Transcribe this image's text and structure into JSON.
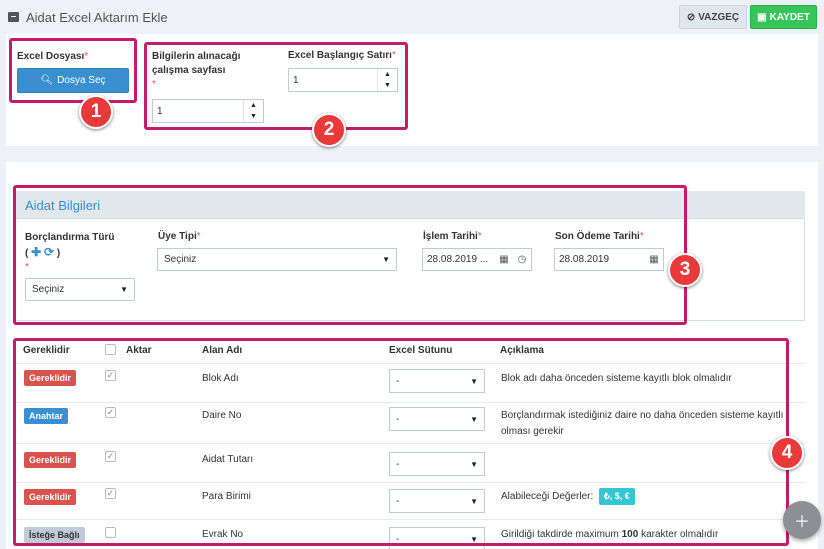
{
  "header": {
    "title": "Aidat Excel Aktarım Ekle",
    "cancel_label": "VAZGEÇ",
    "save_label": "KAYDET"
  },
  "upload": {
    "file_label": "Excel Dosyası",
    "file_button": "Dosya Seç",
    "sheet_label_line1": "Bilgilerin alınacağı",
    "sheet_label_line2": "çalışma sayfası",
    "sheet_value": "1",
    "start_row_label": "Excel Başlangıç Satırı",
    "start_row_value": "1",
    "required_mark": "*"
  },
  "callouts": [
    "1",
    "2",
    "3",
    "4"
  ],
  "aidat": {
    "section_title": "Aidat Bilgileri",
    "borc_label": "Borçlandırma Türü",
    "borc_paren_open": "(",
    "borc_paren_close": ")",
    "borc_value": "Seçiniz",
    "uye_label": "Üye Tipi",
    "uye_value": "Seçiniz",
    "islem_label": "İşlem Tarihi",
    "islem_value": "28.08.2019 ...",
    "son_odeme_label": "Son Ödeme Tarihi",
    "son_odeme_value": "28.08.2019"
  },
  "table": {
    "headers": {
      "gereklidir": "Gereklidir",
      "aktar": "Aktar",
      "alan_adi": "Alan Adı",
      "excel_sutunu": "Excel Sütunu",
      "aciklama": "Açıklama"
    },
    "rows": [
      {
        "tag": "Gereklidir",
        "field": "Blok Adı",
        "column": "-",
        "desc": "Blok adı daha önceden sisteme kayıtlı blok olmalıdır",
        "desc2": ""
      },
      {
        "tag": "Anahtar",
        "field": "Daire No",
        "column": "-",
        "desc": "Borçlandırmak istediğiniz daire no daha önceden sisteme kayıtlı",
        "desc2": "olması gerekir"
      },
      {
        "tag": "Gereklidir",
        "field": "Aidat Tutarı",
        "column": "-",
        "desc": "",
        "desc2": ""
      },
      {
        "tag": "Gereklidir",
        "field": "Para Birimi",
        "column": "-",
        "desc": "Alabileceği Değerler:",
        "desc2": "₺, $, €"
      },
      {
        "tag": "İsteğe Bağlı",
        "field": "Evrak No",
        "column": "-",
        "desc": "Girildiği takdirde maximum",
        "desc_bold": "100",
        "desc_tail": "karakter olmalıdır"
      }
    ]
  },
  "colors": {
    "highlight": "#c41c6a",
    "callout": "#e83a3a",
    "primary": "#3a8fd0",
    "success": "#36c55a",
    "danger": "#d9534f"
  }
}
